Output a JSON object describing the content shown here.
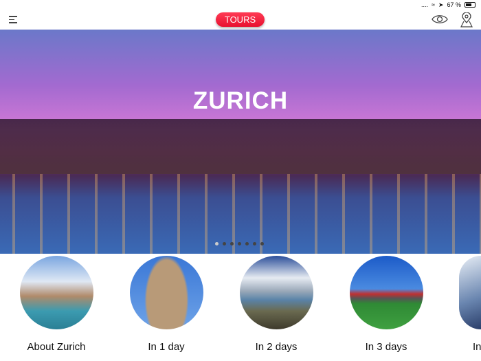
{
  "status": {
    "signal": "....",
    "battery": "67 %",
    "battery_level": 0.67
  },
  "nav": {
    "tours_label": "TOURS"
  },
  "hero": {
    "title": "ZURICH",
    "slides": 7,
    "active_slide": 0
  },
  "tiles": [
    {
      "label": "About Zurich"
    },
    {
      "label": "In 1 day"
    },
    {
      "label": "In 2 days"
    },
    {
      "label": "In 3 days"
    },
    {
      "label": "In"
    }
  ]
}
